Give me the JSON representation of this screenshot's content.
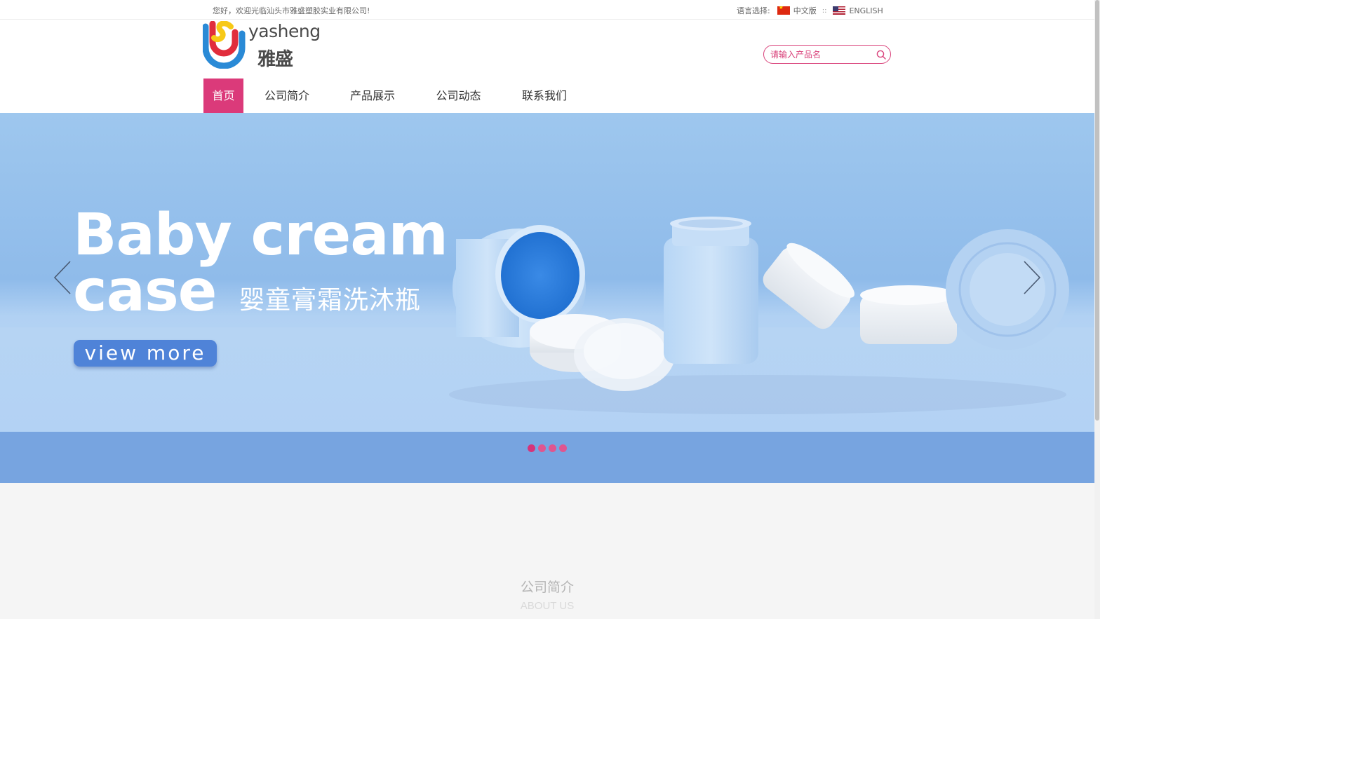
{
  "topbar": {
    "welcome": "您好，欢迎光临汕头市雅盛塑胶实业有限公司!",
    "language_label": "语言选择:",
    "lang_cn": "中文版",
    "separator": "::",
    "lang_en": "ENGLISH"
  },
  "logo": {
    "en": "yasheng",
    "cn": "雅盛"
  },
  "search": {
    "placeholder": "请输入产品名"
  },
  "nav": {
    "items": [
      {
        "label": "首页",
        "active": true
      },
      {
        "label": "公司简介"
      },
      {
        "label": "产品展示"
      },
      {
        "label": "公司动态"
      },
      {
        "label": "联系我们"
      }
    ]
  },
  "banner": {
    "title_line1": "Baby cream",
    "title_line2": "case",
    "subtitle": "婴童膏霜洗沐瓶",
    "button": "view more",
    "slide_count": 4,
    "active_slide": 1
  },
  "about": {
    "title": "公司简介",
    "subtitle": "ABOUT US"
  },
  "colors": {
    "accent": "#db3a7a",
    "banner_bottom": "#77a4e0",
    "button": "#4f83d8"
  }
}
